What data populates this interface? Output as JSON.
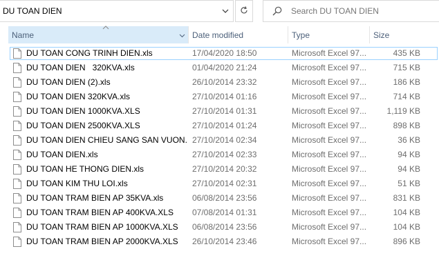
{
  "address": {
    "path": "DU TOAN DIEN"
  },
  "search": {
    "placeholder": "Search DU TOAN DIEN"
  },
  "columns": {
    "name": "Name",
    "date": "Date modified",
    "type": "Type",
    "size": "Size"
  },
  "files": [
    {
      "name": "DU TOAN CONG TRINH DIEN.xls",
      "date": "17/04/2020 18:50",
      "type": "Microsoft Excel 97...",
      "size": "435 KB"
    },
    {
      "name": "DU TOAN DIEN   320KVA.xls",
      "date": "01/04/2020 21:24",
      "type": "Microsoft Excel 97...",
      "size": "715 KB"
    },
    {
      "name": "DU TOAN DIEN (2).xls",
      "date": "26/10/2014 23:32",
      "type": "Microsoft Excel 97...",
      "size": "186 KB"
    },
    {
      "name": "DU TOAN DIEN 320KVA.xls",
      "date": "27/10/2014 01:16",
      "type": "Microsoft Excel 97...",
      "size": "714 KB"
    },
    {
      "name": "DU TOAN DIEN 1000KVA.XLS",
      "date": "27/10/2014 01:31",
      "type": "Microsoft Excel 97...",
      "size": "1,119 KB"
    },
    {
      "name": "DU TOAN DIEN 2500KVA.XLS",
      "date": "27/10/2014 01:24",
      "type": "Microsoft Excel 97...",
      "size": "898 KB"
    },
    {
      "name": "DU TOAN DIEN CHIEU SANG SAN VUON....",
      "date": "27/10/2014 02:34",
      "type": "Microsoft Excel 97...",
      "size": "36 KB"
    },
    {
      "name": "DU TOAN DIEN.xls",
      "date": "27/10/2014 02:33",
      "type": "Microsoft Excel 97...",
      "size": "94 KB"
    },
    {
      "name": "DU TOAN HE THONG DIEN.xls",
      "date": "27/10/2014 20:32",
      "type": "Microsoft Excel 97...",
      "size": "94 KB"
    },
    {
      "name": "DU TOAN KIM THU LOI.xls",
      "date": "27/10/2014 02:31",
      "type": "Microsoft Excel 97...",
      "size": "51 KB"
    },
    {
      "name": "DU TOAN TRAM BIEN AP 35KVA.xls",
      "date": "06/08/2014 23:56",
      "type": "Microsoft Excel 97...",
      "size": "831 KB"
    },
    {
      "name": "DU TOAN TRAM BIEN AP 400KVA.XLS",
      "date": "07/08/2014 01:31",
      "type": "Microsoft Excel 97...",
      "size": "104 KB"
    },
    {
      "name": "DU TOAN TRAM BIEN AP 1000KVA.XLS",
      "date": "06/08/2014 23:56",
      "type": "Microsoft Excel 97...",
      "size": "104 KB"
    },
    {
      "name": "DU TOAN TRAM BIEN AP 2000KVA.XLS",
      "date": "26/10/2014 23:46",
      "type": "Microsoft Excel 97...",
      "size": "896 KB"
    }
  ],
  "icons": {
    "address_dropdown": "chevron-down-icon",
    "refresh": "refresh-icon",
    "search": "search-icon",
    "sort": "sort-ascending-icon",
    "file": "document-icon"
  }
}
